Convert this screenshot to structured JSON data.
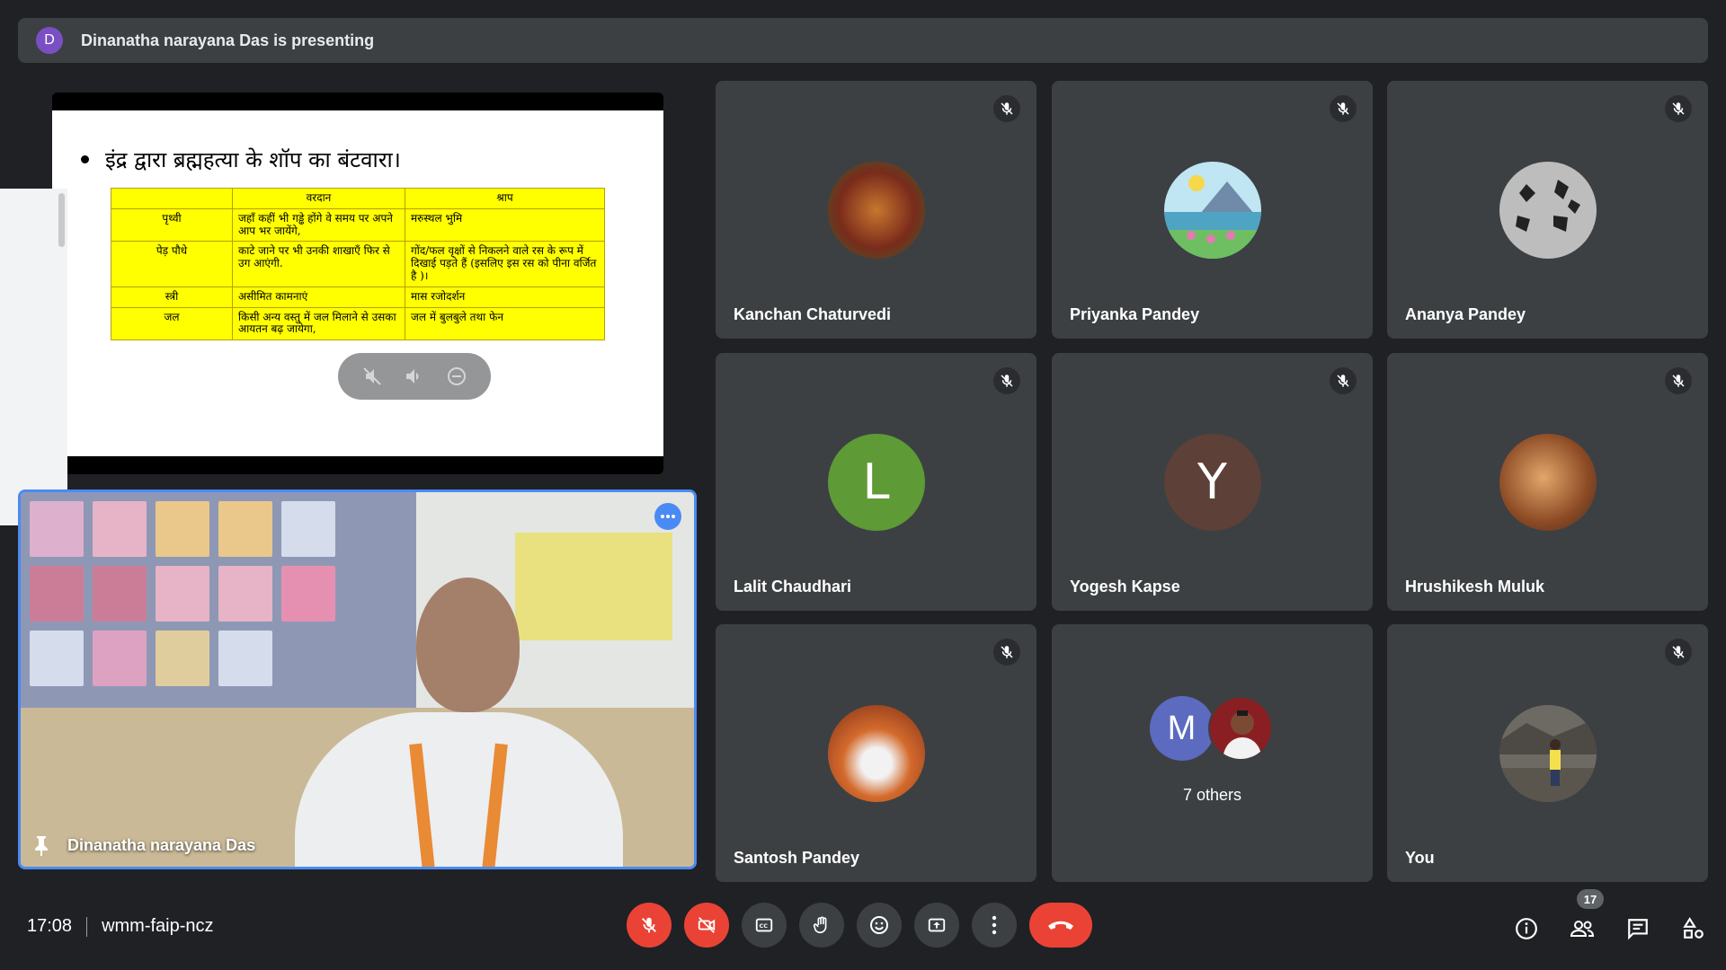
{
  "banner": {
    "initial": "D",
    "text": "Dinanatha narayana Das is presenting"
  },
  "slide": {
    "bullet": "इंद्र द्वारा ब्रह्महत्या के शॉप का बंटवारा।",
    "headers": [
      "",
      "वरदान",
      "श्राप"
    ],
    "rows": [
      [
        "पृथ्वी",
        "जहाँ कहीं भी गड्ढे होंगे वे समय पर अपने आप भर जायेंगे,",
        "मरुस्थल भुमि"
      ],
      [
        "पेड़ पौधे",
        "काटे जाने पर भी उनकी शाखाएँ फिर से उग आएंगी.",
        "गोंद/फल वृक्षों से निकलने वाले रस के रूप में दिखाई पड़ते हैं (इसलिए इस रस को पीना वर्जित है )।"
      ],
      [
        "स्त्री",
        "असीमित कामनाएं",
        "मास रजोदर्शन"
      ],
      [
        "जल",
        "किसी अन्य वस्तु में जल मिलाने से उसका आयतन बढ़ जायेगा,",
        "जल में बुलबुले तथा फेन"
      ]
    ]
  },
  "presenter": {
    "name": "Dinanatha narayana Das"
  },
  "participants": [
    {
      "name": "Kanchan Chaturvedi"
    },
    {
      "name": "Priyanka Pandey"
    },
    {
      "name": "Ananya Pandey"
    },
    {
      "name": "Lalit Chaudhari",
      "initial": "L",
      "color": "#5e9a35"
    },
    {
      "name": "Yogesh Kapse",
      "initial": "Y",
      "color": "#5d4037"
    },
    {
      "name": "Hrushikesh Muluk"
    },
    {
      "name": "Santosh Pandey"
    },
    {
      "name": "7 others",
      "initial": "M",
      "color": "#5c6bc0"
    },
    {
      "name": "You"
    }
  ],
  "bottom": {
    "time": "17:08",
    "meeting_code": "wmm-faip-ncz",
    "people_count": "17"
  },
  "icons": [
    "mic-off-icon",
    "camera-off-icon",
    "captions-icon",
    "raise-hand-icon",
    "emoji-icon",
    "present-icon",
    "more-vert-icon",
    "end-call-icon",
    "info-icon",
    "people-icon",
    "chat-icon",
    "activities-icon"
  ]
}
